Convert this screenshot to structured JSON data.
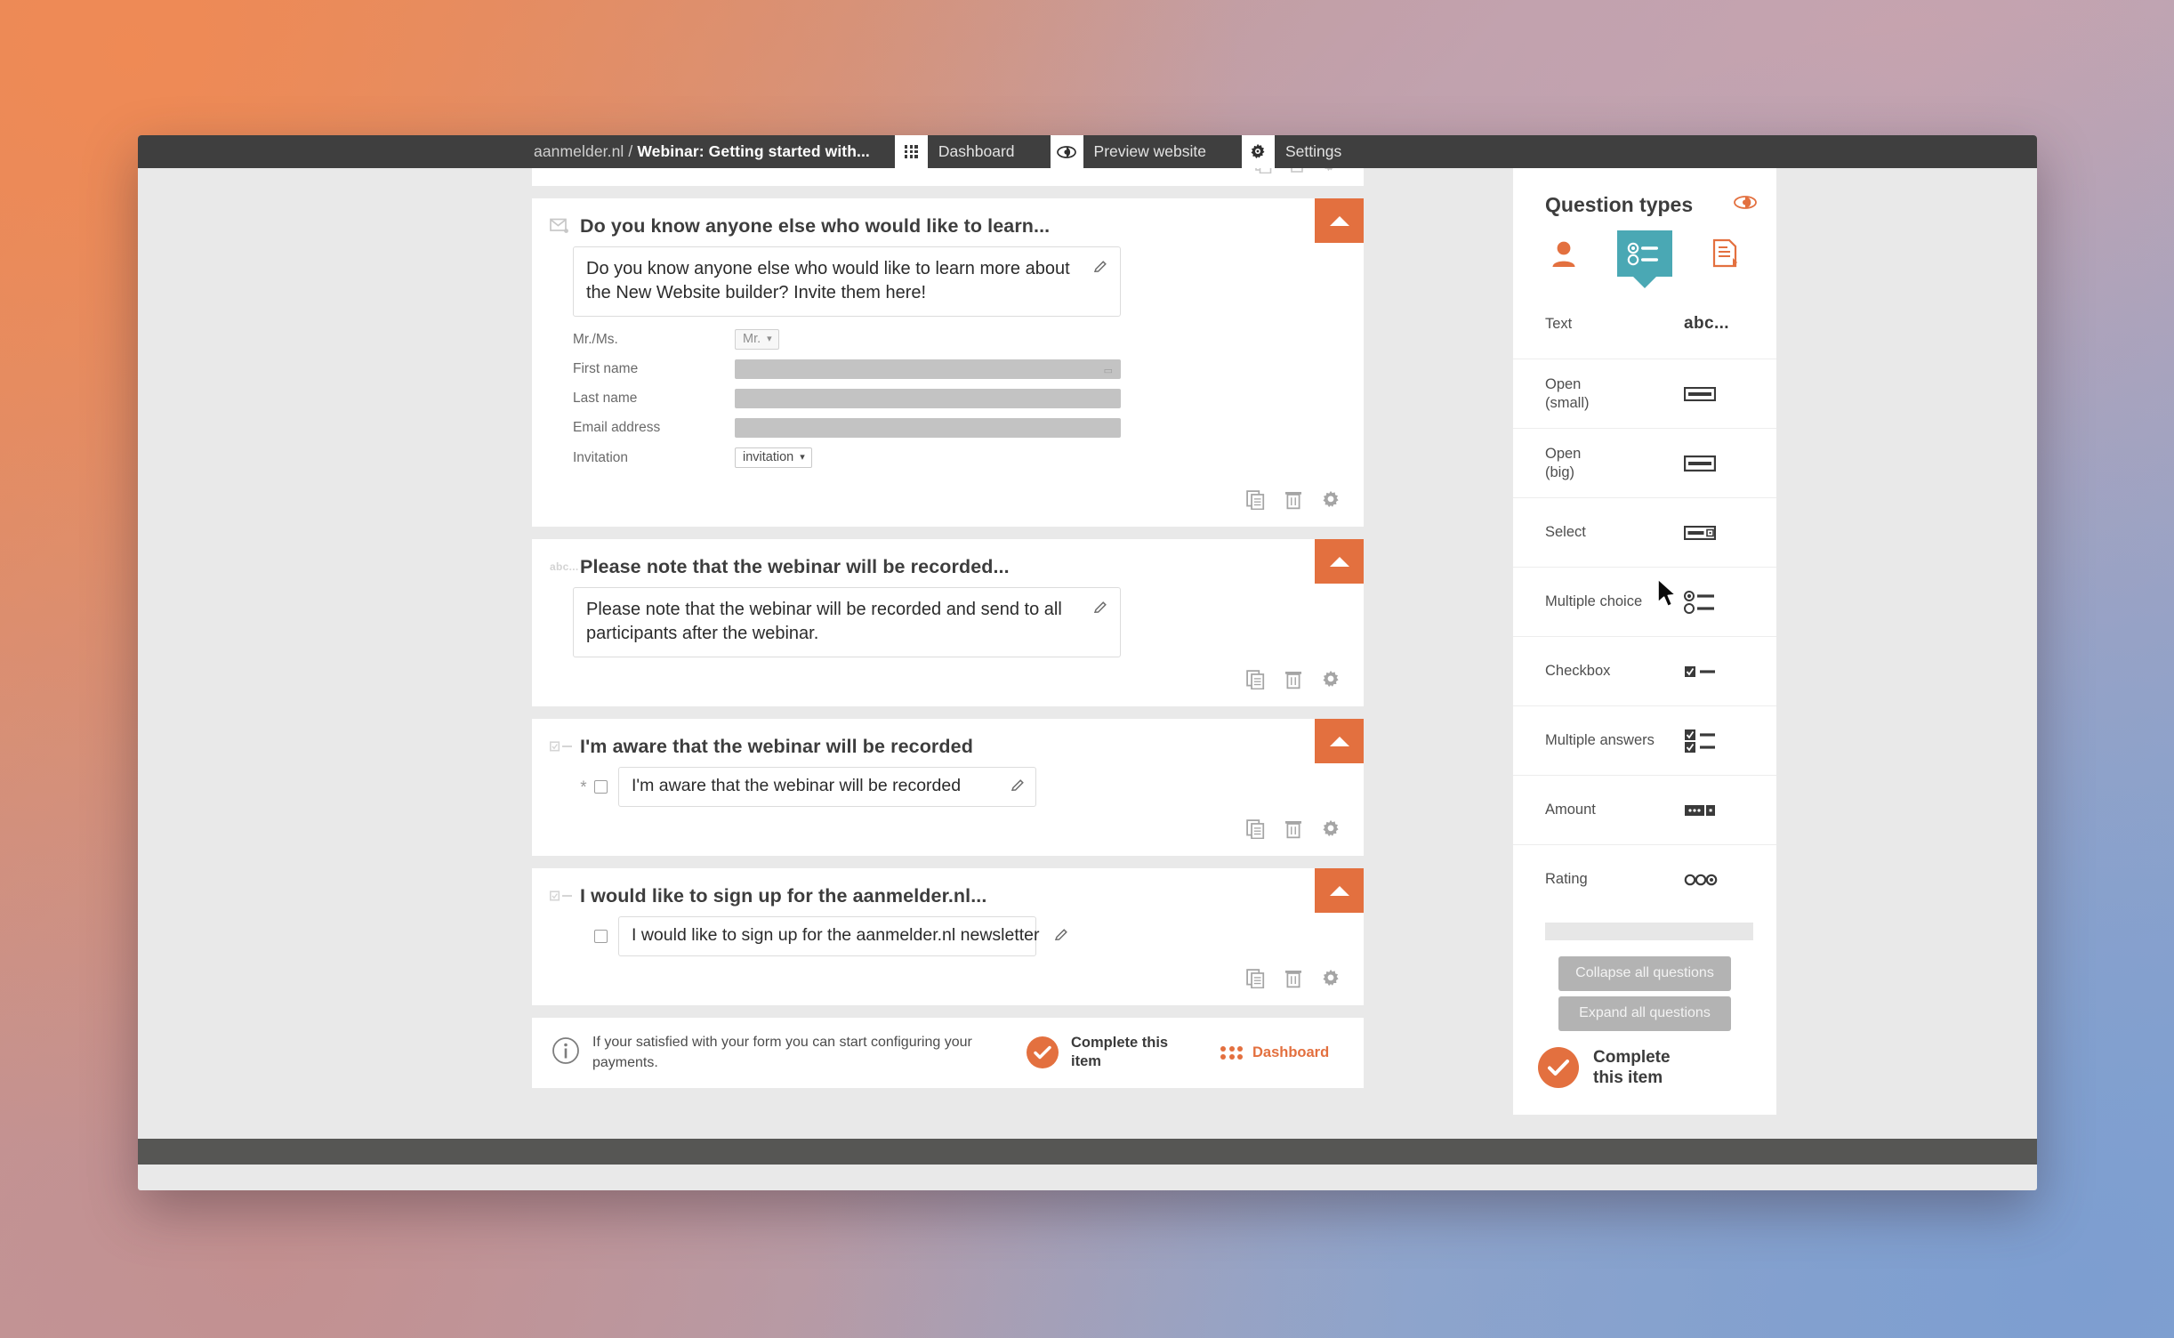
{
  "topbar": {
    "breadcrumb_site": "aanmelder.nl",
    "breadcrumb_separator": "/",
    "breadcrumb_document": "Webinar: Getting started with...",
    "nav": [
      {
        "label": "Dashboard",
        "icon": "grid-dots-icon"
      },
      {
        "label": "Preview website",
        "icon": "eye-icon"
      },
      {
        "label": "Settings",
        "icon": "gear-icon"
      }
    ]
  },
  "cards": [
    {
      "type_icon": "envelope-icon",
      "title": "Do you know anyone else who would like to learn...",
      "prompt": "Do you know anyone else who would like to learn more about the New Website builder? Invite them here!",
      "form_rows": [
        {
          "label": "Mr./Ms.",
          "control": "select",
          "value": "Mr."
        },
        {
          "label": "First name",
          "control": "bar"
        },
        {
          "label": "Last name",
          "control": "bar"
        },
        {
          "label": "Email address",
          "control": "bar"
        },
        {
          "label": "Invitation",
          "control": "select-strong",
          "value": "invitation"
        }
      ]
    },
    {
      "type_icon": "abc-icon",
      "type_icon_label": "abc...",
      "title": "Please note that the webinar will be recorded...",
      "prompt": "Please note that the webinar will be recorded and send to all participants after the webinar."
    },
    {
      "type_icon": "checkbox-line-icon",
      "title": "I'm aware that the webinar will be recorded",
      "required_marker": "*",
      "answer": "I'm aware that the webinar will be recorded"
    },
    {
      "type_icon": "checkbox-line-icon",
      "title": "I would like to sign up for the aanmelder.nl...",
      "answer": "I would like to sign up for the aanmelder.nl newsletter"
    }
  ],
  "card_actions": [
    {
      "name": "duplicate-icon"
    },
    {
      "name": "delete-icon"
    },
    {
      "name": "settings-icon"
    }
  ],
  "infobar": {
    "message": "If your satisfied with your form you can start configuring your payments.",
    "complete_label": "Complete this item",
    "dashboard_label": "Dashboard"
  },
  "sidebar": {
    "title": "Question types",
    "preview_icon": "eye-icon",
    "tabs": [
      {
        "name": "participant-icon",
        "active": false
      },
      {
        "name": "questions-icon",
        "active": true
      },
      {
        "name": "document-upload-icon",
        "active": false
      }
    ],
    "question_types": [
      {
        "label": "Text",
        "glyph": "abc-text-glyph",
        "glyph_text": "abc..."
      },
      {
        "label": "Open\n(small)",
        "glyph": "input-small-glyph"
      },
      {
        "label": "Open\n(big)",
        "glyph": "input-big-glyph"
      },
      {
        "label": "Select",
        "glyph": "select-glyph"
      },
      {
        "label": "Multiple choice",
        "glyph": "radio-list-glyph"
      },
      {
        "label": "Checkbox",
        "glyph": "checkbox-glyph"
      },
      {
        "label": "Multiple answers",
        "glyph": "checkbox-list-glyph"
      },
      {
        "label": "Amount",
        "glyph": "amount-glyph"
      },
      {
        "label": "Rating",
        "glyph": "rating-glyph"
      }
    ],
    "buttons": {
      "collapse_all": "Collapse all questions",
      "expand_all": "Expand all questions"
    },
    "complete_label": "Complete this item"
  },
  "colors": {
    "accent_orange": "#e3703f",
    "tab_teal": "#4aa8b4",
    "topbar_dark": "#3f3f3f"
  }
}
